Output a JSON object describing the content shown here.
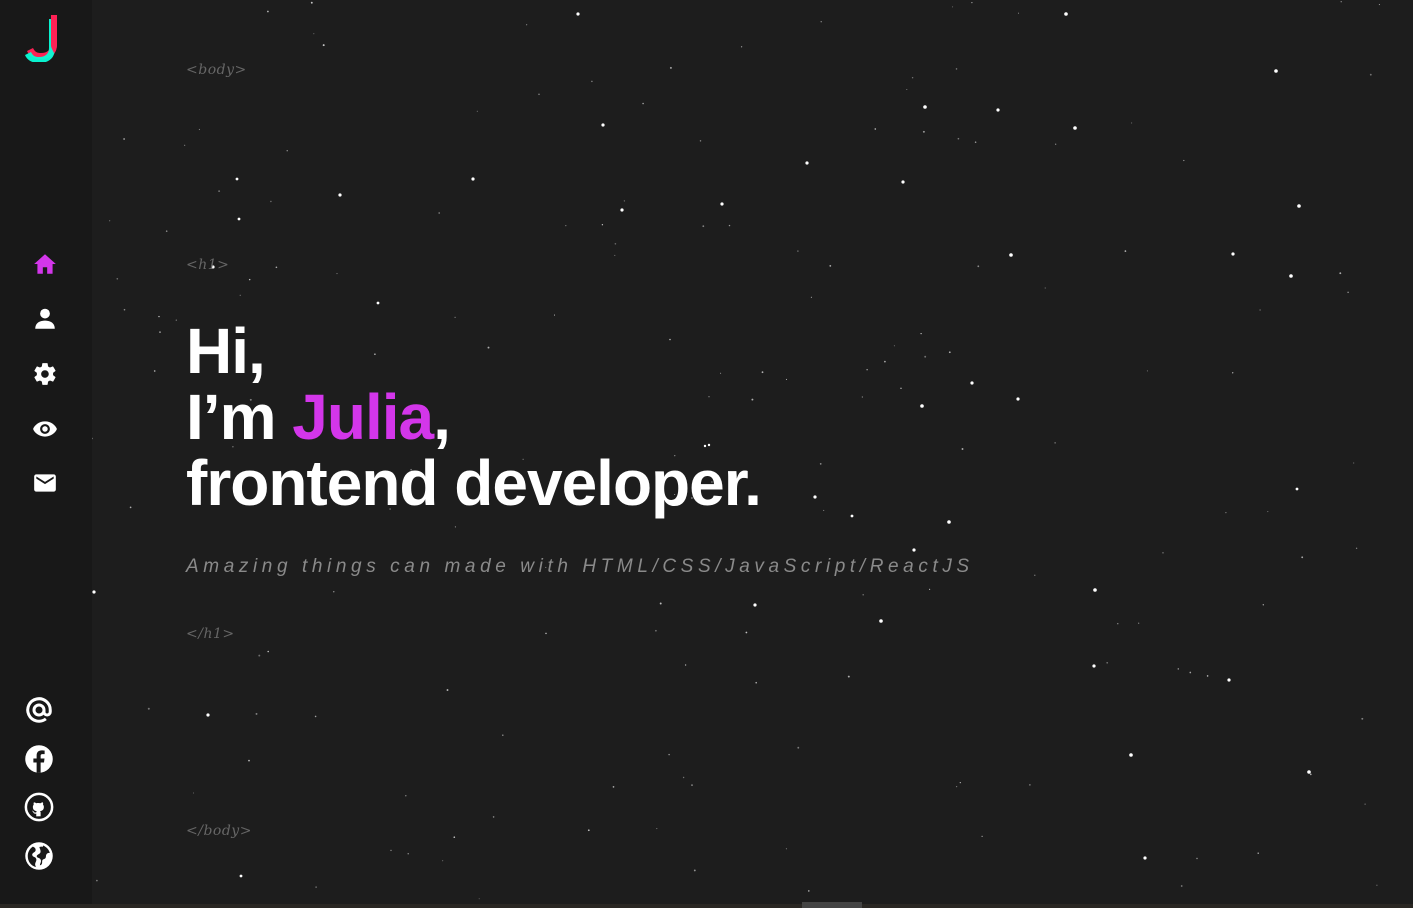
{
  "logo": {
    "letter": "J",
    "colors": [
      "#08fdd8",
      "#fd2155"
    ]
  },
  "nav": {
    "items": [
      {
        "name": "home",
        "icon": "home-icon",
        "active": true
      },
      {
        "name": "about",
        "icon": "user-icon",
        "active": false
      },
      {
        "name": "skills",
        "icon": "gear-icon",
        "active": false
      },
      {
        "name": "work",
        "icon": "eye-icon",
        "active": false
      },
      {
        "name": "contact",
        "icon": "mail-icon",
        "active": false
      }
    ],
    "active_color": "#d336ea",
    "icon_color": "#ffffff"
  },
  "social": {
    "items": [
      {
        "name": "email",
        "icon": "at-icon"
      },
      {
        "name": "facebook",
        "icon": "facebook-icon"
      },
      {
        "name": "github",
        "icon": "github-icon"
      },
      {
        "name": "website",
        "icon": "globe-icon"
      }
    ]
  },
  "tags": {
    "body_open": "<body>",
    "h1_open": "<h1>",
    "h1_close": "</h1>",
    "body_close": "</body>"
  },
  "hero": {
    "line1": "Hi,",
    "line2_prefix": "I’m ",
    "name": "Julia",
    "line2_suffix": ",",
    "line3": "frontend developer.",
    "subtitle": "Amazing things can made with HTML/CSS/JavaScript/ReactJS"
  },
  "colors": {
    "background": "#1d1d1d",
    "sidebar": "#181818",
    "accent": "#d336ea",
    "text": "#ffffff",
    "muted": "#8a8a8a"
  }
}
